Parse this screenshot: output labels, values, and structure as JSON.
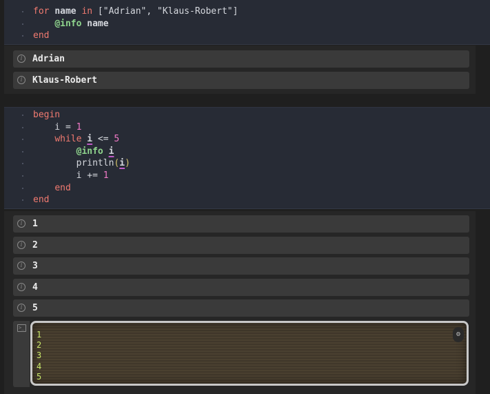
{
  "cell1": {
    "lines": [
      [
        {
          "t": "for",
          "c": "kw"
        },
        {
          "t": " "
        },
        {
          "t": "name",
          "c": "id"
        },
        {
          "t": " "
        },
        {
          "t": "in",
          "c": "kw"
        },
        {
          "t": " [\"Adrian\", \"Klaus-Robert\"]",
          "c": "str"
        }
      ],
      [
        {
          "t": "    "
        },
        {
          "t": "@info",
          "c": "mac"
        },
        {
          "t": " "
        },
        {
          "t": "name",
          "c": "id"
        }
      ],
      [
        {
          "t": "end",
          "c": "kw"
        }
      ]
    ],
    "logs": [
      "Adrian",
      "Klaus-Robert"
    ]
  },
  "cell2": {
    "lines": [
      [
        {
          "t": "begin",
          "c": "kw"
        }
      ],
      [
        {
          "t": "    i = "
        },
        {
          "t": "1",
          "c": "num"
        }
      ],
      [
        {
          "t": "    "
        },
        {
          "t": "while",
          "c": "kw"
        },
        {
          "t": " "
        },
        {
          "t": "i",
          "c": "id ul"
        },
        {
          "t": " <= "
        },
        {
          "t": "5",
          "c": "num"
        }
      ],
      [
        {
          "t": "        "
        },
        {
          "t": "@info",
          "c": "mac"
        },
        {
          "t": " "
        },
        {
          "t": "i",
          "c": "id ul"
        }
      ],
      [
        {
          "t": "        "
        },
        {
          "t": "println",
          "c": "fn"
        },
        {
          "t": "(",
          "c": "paren"
        },
        {
          "t": "i",
          "c": "id ul"
        },
        {
          "t": ")",
          "c": "paren"
        }
      ],
      [
        {
          "t": "        i += "
        },
        {
          "t": "1",
          "c": "num"
        }
      ],
      [
        {
          "t": "    "
        },
        {
          "t": "end",
          "c": "kw"
        }
      ],
      [
        {
          "t": "end",
          "c": "kw"
        }
      ]
    ],
    "logs": [
      "1",
      "2",
      "3",
      "4",
      "5"
    ],
    "stdout": "1\n2\n3\n4\n5"
  },
  "icons": {
    "info": "info-icon",
    "terminal": "terminal-icon",
    "stdout_action": "settings-icon"
  }
}
